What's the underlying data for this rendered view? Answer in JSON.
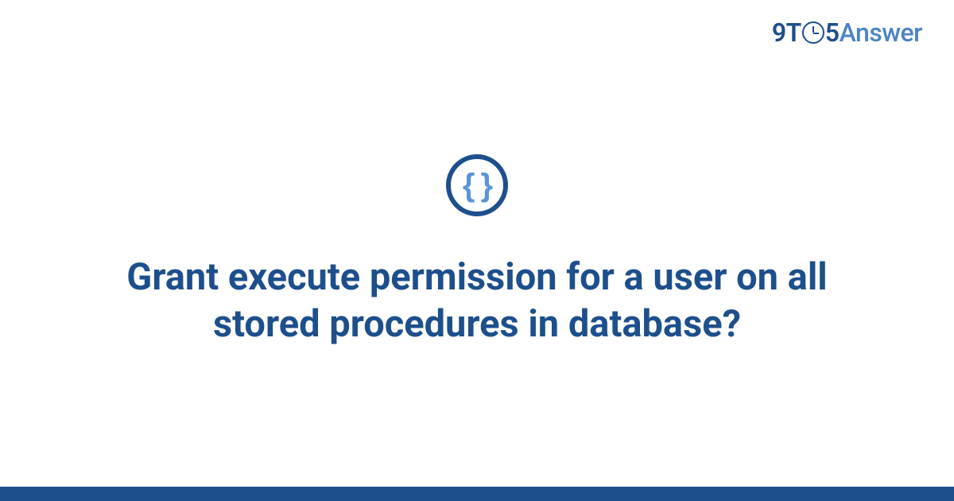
{
  "brand": {
    "part_9t": "9T",
    "part_5": "5",
    "part_answer": "Answer"
  },
  "icon": {
    "glyph": "{ }",
    "name": "code-braces-icon"
  },
  "question": {
    "title": "Grant execute permission for a user on all stored procedures in database?"
  },
  "colors": {
    "primary": "#1d4f8c",
    "accent": "#4a84c4",
    "icon_glyph": "#5b95d6"
  }
}
